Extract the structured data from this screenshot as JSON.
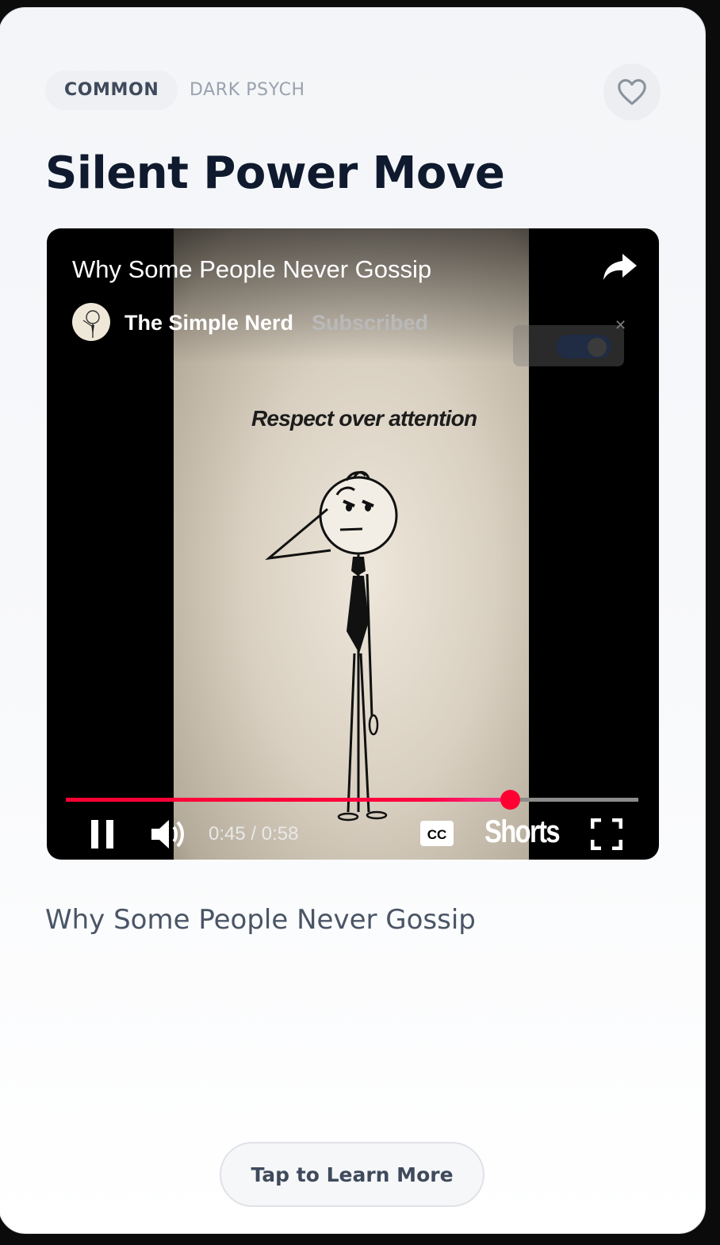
{
  "tags": {
    "active": "COMMON",
    "inactive": "DARK PSYCH"
  },
  "favorite": {
    "icon": "heart-outline-icon"
  },
  "card_title": "Silent Power Move",
  "video": {
    "title": "Why Some People Never Gossip",
    "channel": "The Simple Nerd",
    "subscription_status": "Subscribed",
    "overlay_text": "Respect over attention",
    "current_time": "0:45",
    "duration": "0:58",
    "time_display": "0:45 / 0:58",
    "progress_fraction": 0.7759,
    "shorts_label": "Shorts",
    "accent_color": "#ff0033",
    "controls": {
      "pause_icon": "pause-icon",
      "volume_icon": "volume-icon",
      "captions_icon": "cc-icon",
      "fullscreen_icon": "fullscreen-icon",
      "share_icon": "share-icon"
    }
  },
  "caption": "Why Some People Never Gossip",
  "cta": {
    "label": "Tap to Learn More"
  },
  "colors": {
    "title": "#0f1a2e",
    "body_text": "#4a5566",
    "muted": "#9aa2af"
  }
}
